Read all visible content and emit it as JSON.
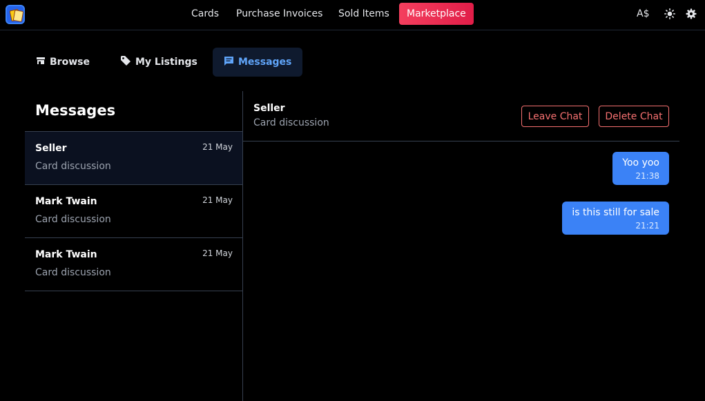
{
  "nav": {
    "items": [
      "Cards",
      "Purchase Invoices",
      "Sold Items",
      "Marketplace"
    ],
    "active": "Marketplace",
    "currency": "A$"
  },
  "tabs": [
    {
      "label": "Browse",
      "icon": "store-icon"
    },
    {
      "label": "My Listings",
      "icon": "tag-icon"
    },
    {
      "label": "Messages",
      "icon": "message-icon"
    }
  ],
  "active_tab": "Messages",
  "messages_panel": {
    "title": "Messages",
    "conversations": [
      {
        "name": "Seller",
        "date": "21 May",
        "subtitle": "Card discussion",
        "selected": true
      },
      {
        "name": "Mark Twain",
        "date": "21 May",
        "subtitle": "Card discussion",
        "selected": false
      },
      {
        "name": "Mark Twain",
        "date": "21 May",
        "subtitle": "Card discussion",
        "selected": false
      }
    ]
  },
  "chat": {
    "name": "Seller",
    "subtitle": "Card discussion",
    "leave_label": "Leave Chat",
    "delete_label": "Delete Chat",
    "messages": [
      {
        "text": "Yoo yoo",
        "time": "21:38"
      },
      {
        "text": "is this still for sale",
        "time": "21:21"
      }
    ]
  },
  "colors": {
    "accent": "#3b82f6",
    "active_nav": "#e11d48",
    "danger": "#f87171",
    "background": "#000000"
  }
}
